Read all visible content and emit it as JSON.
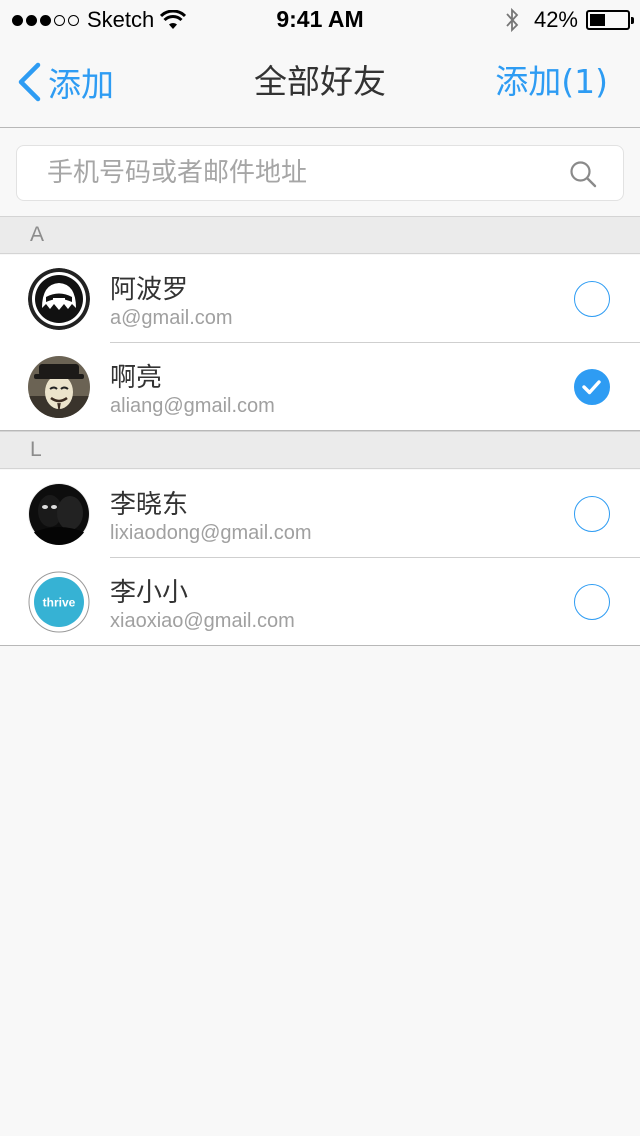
{
  "status_bar": {
    "carrier": "Sketch",
    "time": "9:41 AM",
    "battery_percent": "42%",
    "battery_level": 0.42
  },
  "nav": {
    "back_label": "添加",
    "title": "全部好友",
    "add_label": "添加(1)"
  },
  "search": {
    "placeholder": "手机号码或者邮件地址"
  },
  "sections": [
    {
      "letter": "A",
      "contacts": [
        {
          "name": "阿波罗",
          "email": "a@gmail.com",
          "selected": false,
          "avatar": "ghost-mask-avatar"
        },
        {
          "name": "啊亮",
          "email": "aliang@gmail.com",
          "selected": true,
          "avatar": "guy-fawkes-avatar"
        }
      ]
    },
    {
      "letter": "L",
      "contacts": [
        {
          "name": "李晓东",
          "email": "lixiaodong@gmail.com",
          "selected": false,
          "avatar": "masked-figures-avatar"
        },
        {
          "name": "李小小",
          "email": "xiaoxiao@gmail.com",
          "selected": false,
          "avatar": "thrive-logo-avatar",
          "avatar_text": "thrive"
        }
      ]
    }
  ],
  "colors": {
    "accent": "#2e9cf3",
    "thrive": "#36b2d4"
  }
}
